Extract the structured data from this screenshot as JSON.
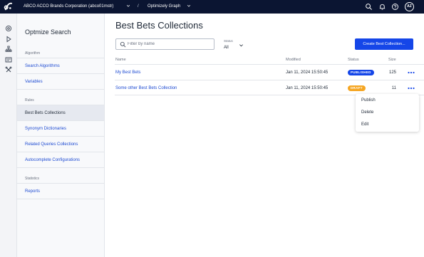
{
  "topbar": {
    "org": "ABCO ACCO Brands Corporation (abco01mstr)",
    "separator": "/",
    "product": "Optimizely Graph",
    "avatar": "AZ"
  },
  "sidebar": {
    "title": "Optmize Search",
    "sections": [
      {
        "label": "Algorithm",
        "items": [
          "Search Algorithms",
          "Variables"
        ]
      },
      {
        "label": "Rules",
        "items": [
          "Best Bets Collections",
          "Synonym Dictionaries",
          "Related Queries Collections",
          "Autocomplete Configurations"
        ]
      },
      {
        "label": "Statistics",
        "items": [
          "Reports"
        ]
      }
    ],
    "active_item": "Best Bets Collections"
  },
  "main": {
    "title": "Best Bets Collections",
    "filter_placeholder": "Filter by name",
    "status_label": "Status",
    "status_value": "All",
    "create_button": "Create Best Collection...",
    "columns": {
      "name": "Name",
      "modified": "Modified",
      "status": "Status",
      "size": "Size"
    },
    "rows": [
      {
        "name": "My Best Bets",
        "modified": "Jan 11, 2024 15:50:45",
        "status": "PUBLISHED",
        "size": "125"
      },
      {
        "name": "Some other Best Bets Collection",
        "modified": "Jan 11, 2024 15:50:45",
        "status": "DRAFT",
        "size": "11"
      }
    ],
    "row_menu": [
      "Publish",
      "Delete",
      "Edit"
    ]
  },
  "colors": {
    "topbar_bg": "#0b1532",
    "accent": "#1546e8",
    "link": "#1e4bd2",
    "published_badge": "#1546e8",
    "draft_badge": "#f5a623"
  },
  "icons": {
    "rail": [
      "settings-icon",
      "play-icon",
      "hierarchy-icon",
      "list-box-icon",
      "tools-icon"
    ],
    "topbar": [
      "search-icon",
      "bell-icon",
      "help-icon"
    ]
  }
}
